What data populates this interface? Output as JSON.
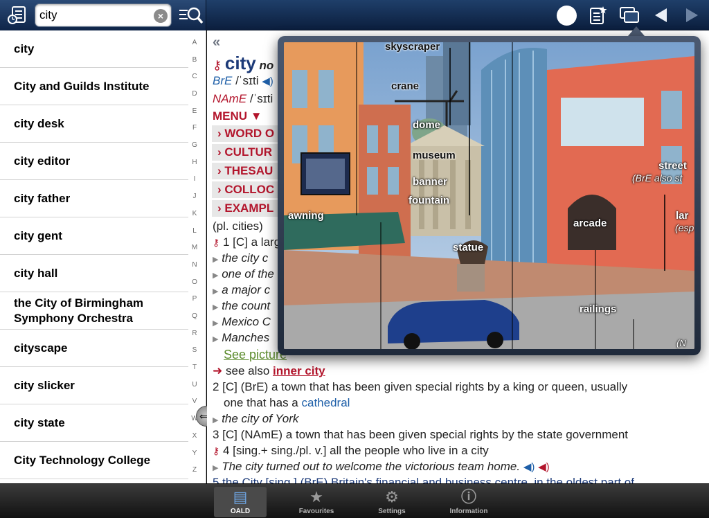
{
  "search": {
    "value": "city",
    "clear_symbol": "×"
  },
  "word_list": [
    "city",
    "City and Guilds Institute",
    "city desk",
    "city editor",
    "city father",
    "city gent",
    "city hall",
    "the City of Birmingham Symphony Orchestra",
    "cityscape",
    "city slicker",
    "city state",
    "City Technology College"
  ],
  "alphabet": [
    "A",
    "B",
    "C",
    "D",
    "E",
    "F",
    "G",
    "H",
    "I",
    "J",
    "K",
    "L",
    "M",
    "N",
    "O",
    "P",
    "Q",
    "R",
    "S",
    "T",
    "U",
    "V",
    "W",
    "X",
    "Y",
    "Z"
  ],
  "entry": {
    "nav_back": "«",
    "headword": "city",
    "headword_suffix": "no",
    "bre_label": "BrE",
    "bre_pron": "/ˈsɪti",
    "name_label": "NAmE",
    "name_pron": "/ˈsɪti",
    "menu_label": "MENU ▼",
    "menu_items": [
      "› WORD O",
      "› CULTUR",
      "› THESAU",
      "› COLLOC",
      "› EXAMPL"
    ],
    "plural_note": "(pl. cities)",
    "sense1": "1 [C] a larg",
    "examples": [
      "the city c",
      "one of the",
      "a major c",
      "the count",
      "Mexico C",
      "Manches"
    ],
    "see_picture": "See picture",
    "see_also_prefix": "see also",
    "see_also_link": "inner city",
    "sense2_a": "2 [C] (BrE) a town that has been given special rights by a king or queen, usually",
    "sense2_b_text": "one that has a",
    "sense2_b_link": "cathedral",
    "sense2_example": "the city of York",
    "sense3": "3 [C] (NAmE) a town that has been given special rights by the state government",
    "sense4": "4 [sing.+ sing./pl. v.] all the people who live in a city",
    "sense4_example": "The city turned out to welcome the victorious team home.",
    "sense5": "5 the City [sing.] (BrE) Britain's financial and business centre, in the oldest part of"
  },
  "picture_labels": [
    "skyscraper",
    "crane",
    "dome",
    "museum",
    "banner",
    "fountain",
    "awning",
    "statue",
    "street",
    "(BrE also st",
    "arcade",
    "railings",
    "lar",
    "(esp",
    "(N"
  ],
  "tabs": [
    {
      "label": "OALD",
      "icon": "book-icon"
    },
    {
      "label": "Favourites",
      "icon": "star-icon"
    },
    {
      "label": "Settings",
      "icon": "gear-icon"
    },
    {
      "label": "Information",
      "icon": "info-icon"
    }
  ]
}
